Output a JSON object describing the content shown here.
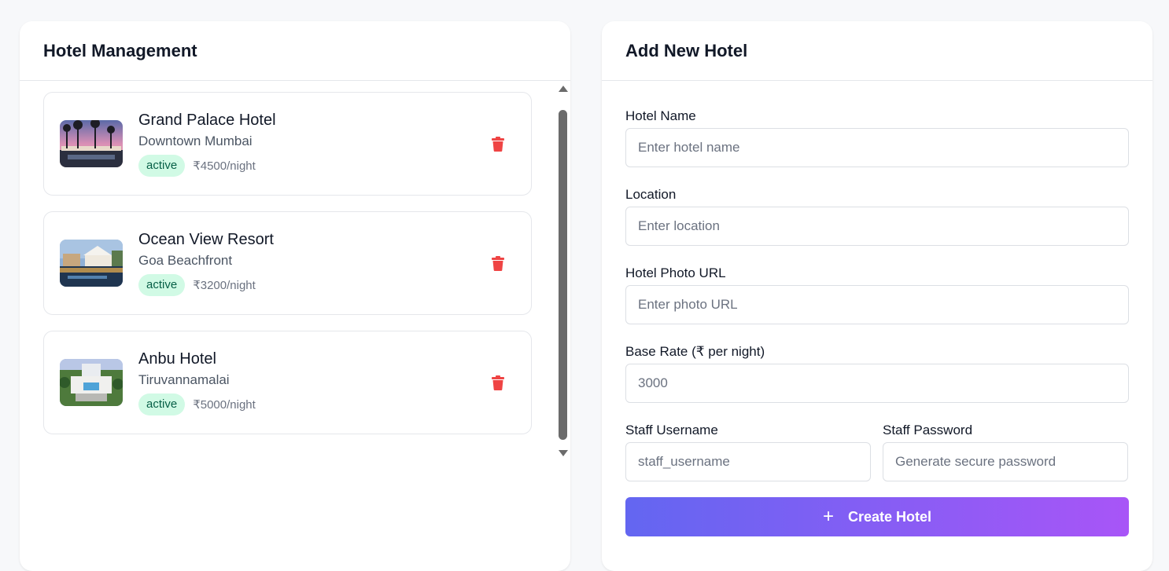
{
  "hotel_panel": {
    "title": "Hotel Management",
    "hotels": [
      {
        "name": "Grand Palace Hotel",
        "location": "Downtown Mumbai",
        "status": "active",
        "rate": "₹4500/night"
      },
      {
        "name": "Ocean View Resort",
        "location": "Goa Beachfront",
        "status": "active",
        "rate": "₹3200/night"
      },
      {
        "name": "Anbu Hotel",
        "location": "Tiruvannamalai",
        "status": "active",
        "rate": "₹5000/night"
      }
    ]
  },
  "form_panel": {
    "title": "Add New Hotel",
    "hotel_name": {
      "label": "Hotel Name",
      "placeholder": "Enter hotel name"
    },
    "location": {
      "label": "Location",
      "placeholder": "Enter location"
    },
    "photo_url": {
      "label": "Hotel Photo URL",
      "placeholder": "Enter photo URL"
    },
    "base_rate": {
      "label": "Base Rate (₹ per night)",
      "placeholder": "3000"
    },
    "staff_username": {
      "label": "Staff Username",
      "placeholder": "staff_username"
    },
    "staff_password": {
      "label": "Staff Password",
      "placeholder": "Generate secure password"
    },
    "submit": {
      "icon": "+",
      "label": "Create Hotel"
    }
  },
  "colors": {
    "badge_bg": "#d1fae5",
    "badge_text": "#065f46",
    "delete": "#ef4444",
    "button_gradient_start": "#6366f1",
    "button_gradient_end": "#a855f7"
  }
}
